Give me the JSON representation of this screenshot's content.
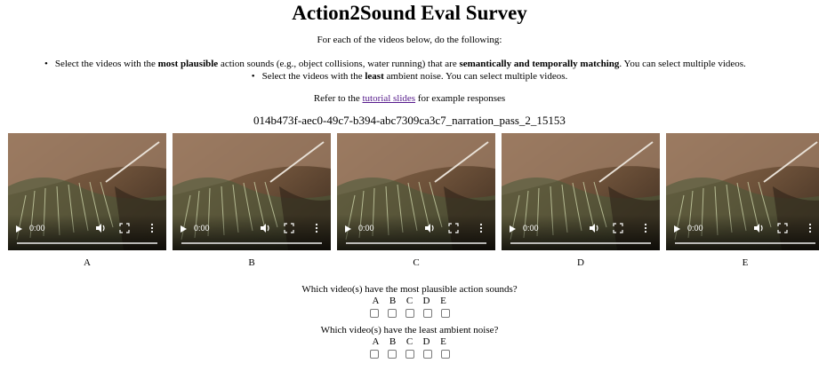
{
  "title": "Action2Sound Eval Survey",
  "intro": "For each of the videos below, do the following:",
  "instruction_1": {
    "bullet": "•",
    "p1": "Select the videos with the ",
    "b1": "most plausible",
    "p2": " action sounds (e.g., object collisions, water running) that are ",
    "b2": "semantically and temporally matching",
    "p3": ". You can select multiple videos."
  },
  "instruction_2": {
    "bullet": "•",
    "p1": "Select the videos with the ",
    "b1": "least",
    "p2": " ambient noise. You can select multiple videos."
  },
  "refer": {
    "before": "Refer to the ",
    "link": "tutorial slides",
    "after": " for example responses"
  },
  "clip_id": "014b473f-aec0-49c7-b394-abc7309ca3c7_narration_pass_2_15153",
  "videos": [
    {
      "label": "A",
      "time": "0:00"
    },
    {
      "label": "B",
      "time": "0:00"
    },
    {
      "label": "C",
      "time": "0:00"
    },
    {
      "label": "D",
      "time": "0:00"
    },
    {
      "label": "E",
      "time": "0:00"
    }
  ],
  "questions": [
    {
      "text": "Which video(s) have the most plausible action sounds?",
      "options": [
        "A",
        "B",
        "C",
        "D",
        "E"
      ]
    },
    {
      "text": "Which video(s) have the least ambient noise?",
      "options": [
        "A",
        "B",
        "C",
        "D",
        "E"
      ]
    }
  ],
  "icons": {
    "play": "play-icon",
    "volume": "volume-icon",
    "fullscreen": "fullscreen-icon",
    "more": "more-options-icon"
  }
}
